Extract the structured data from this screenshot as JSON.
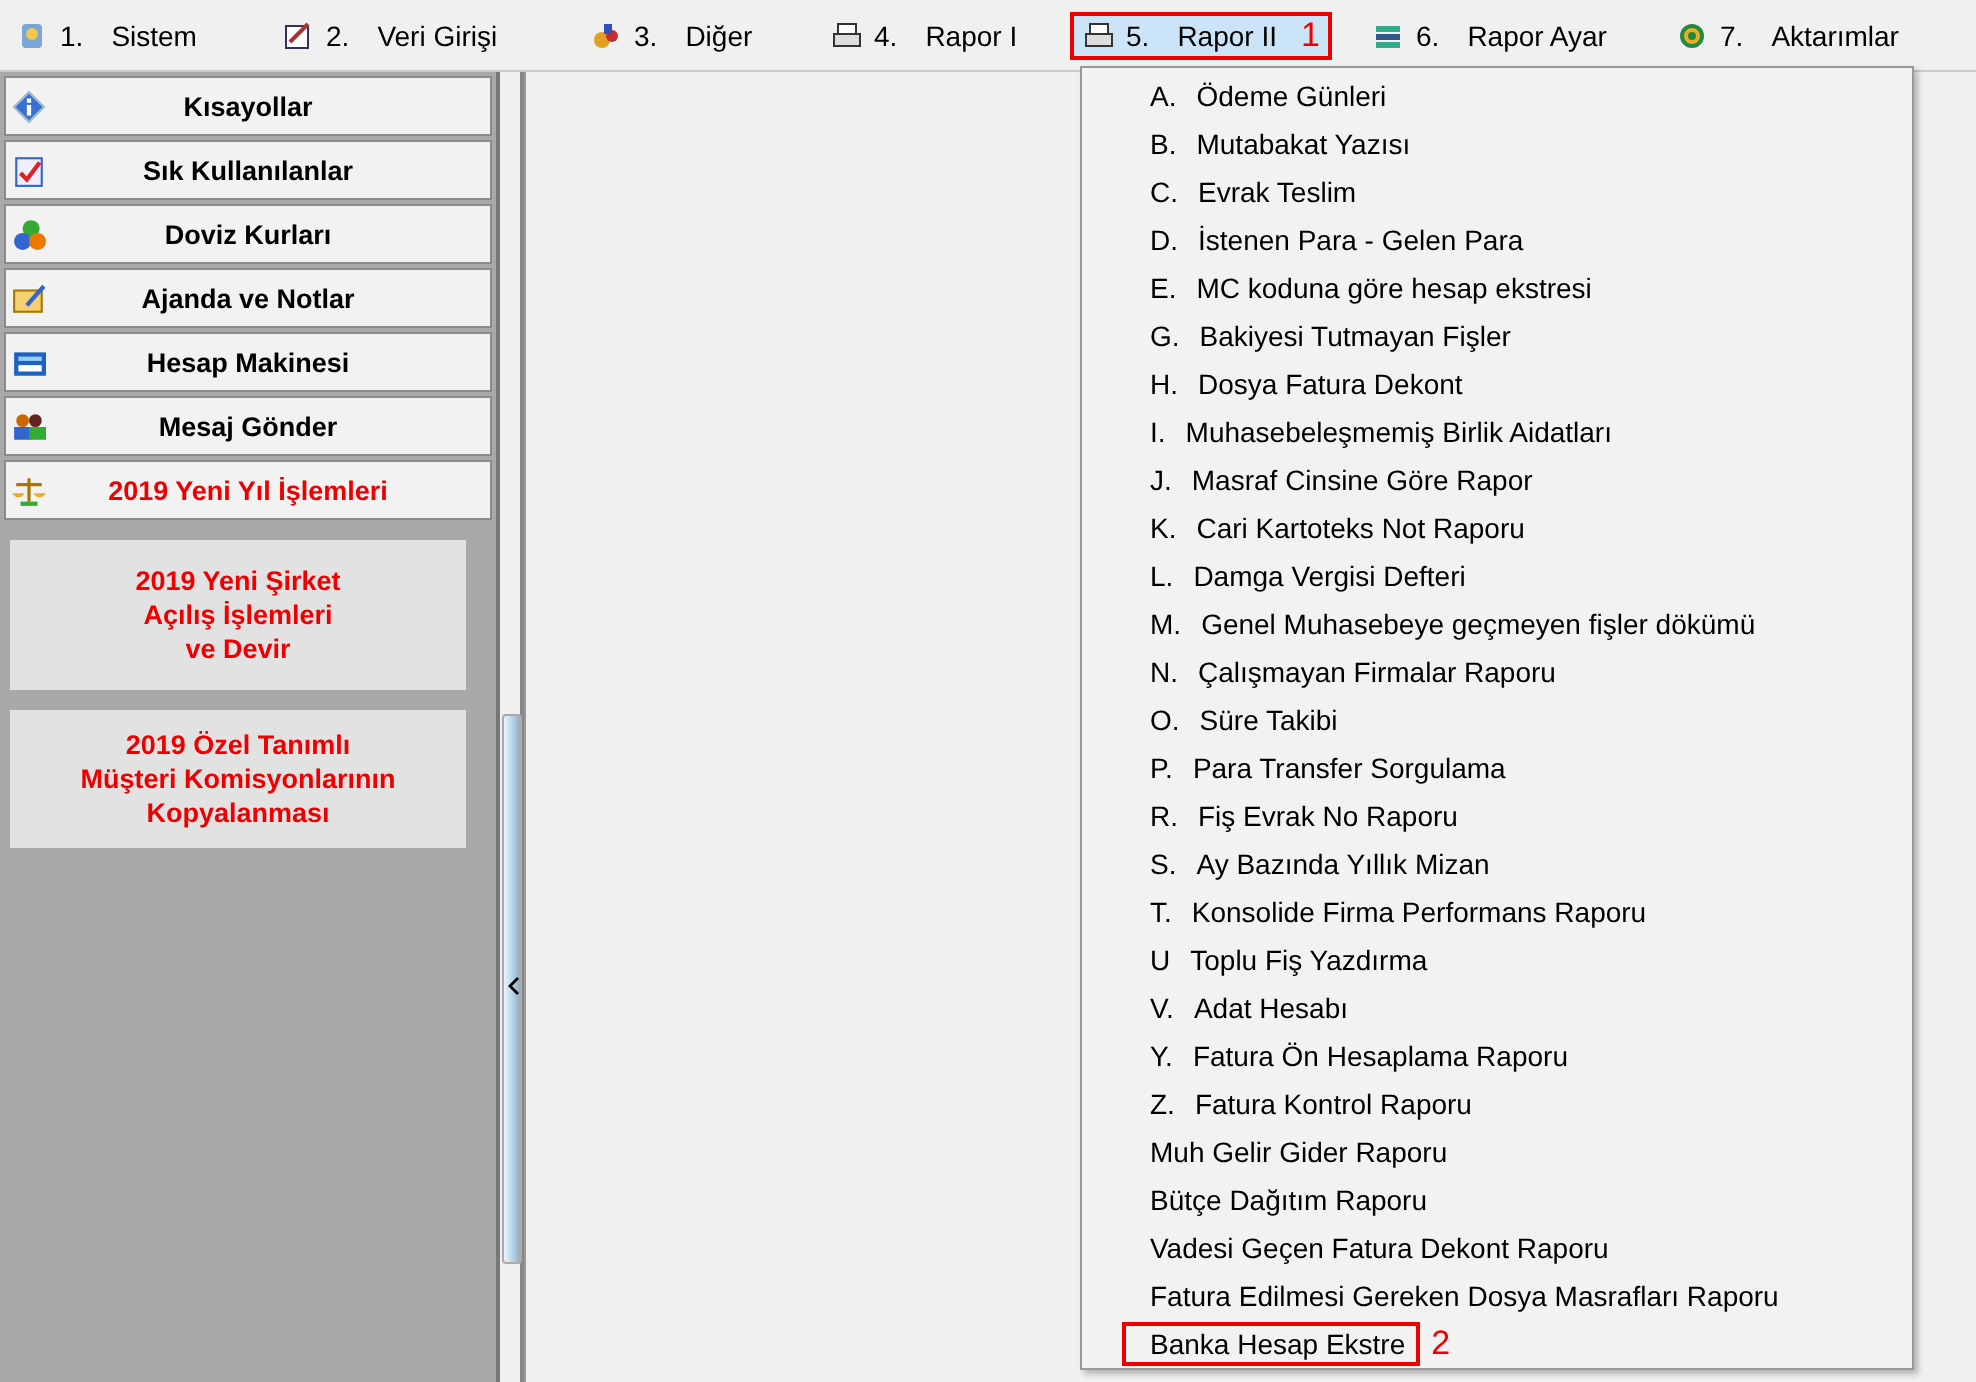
{
  "menubar": [
    {
      "number": "1.",
      "label": "Sistem",
      "selected": false
    },
    {
      "number": "2.",
      "label": "Veri Girişi",
      "selected": false
    },
    {
      "number": "3.",
      "label": "Diğer",
      "selected": false
    },
    {
      "number": "4.",
      "label": "Rapor I",
      "selected": false
    },
    {
      "number": "5.",
      "label": "Rapor II",
      "selected": true,
      "callout": "1"
    },
    {
      "number": "6.",
      "label": "Rapor Ayar",
      "selected": false
    },
    {
      "number": "7.",
      "label": "Aktarımlar",
      "selected": false
    }
  ],
  "sidebar": {
    "items": [
      {
        "label": "Kısayollar",
        "highlighted": false
      },
      {
        "label": "Sık Kullanılanlar",
        "highlighted": false
      },
      {
        "label": "Doviz Kurları",
        "highlighted": false
      },
      {
        "label": "Ajanda ve Notlar",
        "highlighted": false
      },
      {
        "label": "Hesap Makinesi",
        "highlighted": false
      },
      {
        "label": "Mesaj Gönder",
        "highlighted": false
      },
      {
        "label": "2019 Yeni Yıl İşlemleri",
        "highlighted": true
      }
    ],
    "buttons": [
      {
        "lines": [
          "2019 Yeni Şirket",
          "Açılış İşlemleri",
          "ve Devir"
        ]
      },
      {
        "lines": [
          "2019 Özel Tanımlı",
          "Müşteri Komisyonlarının",
          "Kopyalanması"
        ]
      }
    ]
  },
  "dropdown": {
    "items": [
      {
        "key": "A.",
        "label": "Ödeme Günleri"
      },
      {
        "key": "B.",
        "label": "Mutabakat Yazısı"
      },
      {
        "key": "C.",
        "label": "Evrak Teslim"
      },
      {
        "key": "D.",
        "label": "İstenen Para - Gelen Para"
      },
      {
        "key": "E.",
        "label": "MC koduna göre hesap ekstresi"
      },
      {
        "key": "G.",
        "label": "Bakiyesi Tutmayan Fişler"
      },
      {
        "key": "H.",
        "label": "Dosya Fatura Dekont"
      },
      {
        "key": "I.",
        "label": "Muhasebeleşmemiş Birlik Aidatları"
      },
      {
        "key": "J.",
        "label": "Masraf Cinsine Göre Rapor"
      },
      {
        "key": "K.",
        "label": "Cari Kartoteks Not Raporu"
      },
      {
        "key": "L.",
        "label": "Damga Vergisi Defteri"
      },
      {
        "key": "M.",
        "label": "Genel Muhasebeye geçmeyen fişler dökümü"
      },
      {
        "key": "N.",
        "label": "Çalışmayan Firmalar Raporu"
      },
      {
        "key": "O.",
        "label": "Süre Takibi"
      },
      {
        "key": "P.",
        "label": "Para Transfer Sorgulama"
      },
      {
        "key": "R.",
        "label": "Fiş Evrak No Raporu"
      },
      {
        "key": "S.",
        "label": "Ay Bazında Yıllık Mizan"
      },
      {
        "key": "T.",
        "label": "Konsolide Firma Performans Raporu"
      },
      {
        "key": "U",
        "label": "Toplu Fiş Yazdırma"
      },
      {
        "key": "V.",
        "label": "Adat Hesabı"
      },
      {
        "key": "Y.",
        "label": "Fatura Ön Hesaplama Raporu"
      },
      {
        "key": "Z.",
        "label": "Fatura Kontrol Raporu"
      },
      {
        "label": "Muh Gelir Gider Raporu"
      },
      {
        "label": "Bütçe Dağıtım Raporu"
      },
      {
        "label": "Vadesi Geçen Fatura Dekont Raporu"
      },
      {
        "label": "Fatura Edilmesi Gereken Dosya Masrafları Raporu"
      },
      {
        "label": "Banka Hesap Ekstre",
        "callout": "2"
      }
    ]
  }
}
